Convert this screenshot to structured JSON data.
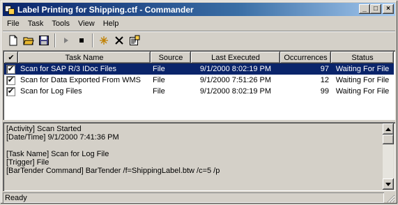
{
  "window": {
    "title": "Label Printing for Shipping.ctf - Commander",
    "minimize_glyph": "_",
    "maximize_glyph": "□",
    "close_glyph": "×"
  },
  "menu": [
    {
      "label": "File"
    },
    {
      "label": "Task"
    },
    {
      "label": "Tools"
    },
    {
      "label": "View"
    },
    {
      "label": "Help"
    }
  ],
  "toolbar": {
    "icons": [
      "new-document-icon",
      "open-folder-icon",
      "save-icon",
      "play-icon",
      "stop-icon",
      "spark-icon",
      "delete-icon",
      "properties-icon"
    ]
  },
  "tasks": {
    "columns": [
      "✔",
      "Task Name",
      "Source",
      "Last Executed",
      "Occurrences",
      "Status"
    ],
    "rows": [
      {
        "checked": "✔",
        "name": "Scan for SAP R/3 IDoc Files",
        "source": "File",
        "last_executed": "9/1/2000 8:02:19 PM",
        "occurrences": "97",
        "status": "Waiting For File",
        "selected": true
      },
      {
        "checked": "✔",
        "name": "Scan for Data Exported From WMS",
        "source": "File",
        "last_executed": "9/1/2000 7:51:26 PM",
        "occurrences": "12",
        "status": "Waiting For File",
        "selected": false
      },
      {
        "checked": "✔",
        "name": "Scan for Log Files",
        "source": "File",
        "last_executed": "9/1/2000 8:02:19 PM",
        "occurrences": "99",
        "status": "Waiting For File",
        "selected": false
      }
    ]
  },
  "log": {
    "lines": [
      "[Activity] Scan Started",
      "[Date/Time] 9/1/2000 7:41:36 PM",
      "",
      "[Task Name] Scan for Log File",
      "[Trigger] File",
      "[BarTender Command] BarTender /f=ShippingLabel.btw /c=5 /p"
    ]
  },
  "statusbar": {
    "text": "Ready"
  },
  "colors": {
    "selection": "#0a246a",
    "title_start": "#0a246a",
    "title_end": "#a6caf0",
    "face": "#d4d0c8"
  }
}
